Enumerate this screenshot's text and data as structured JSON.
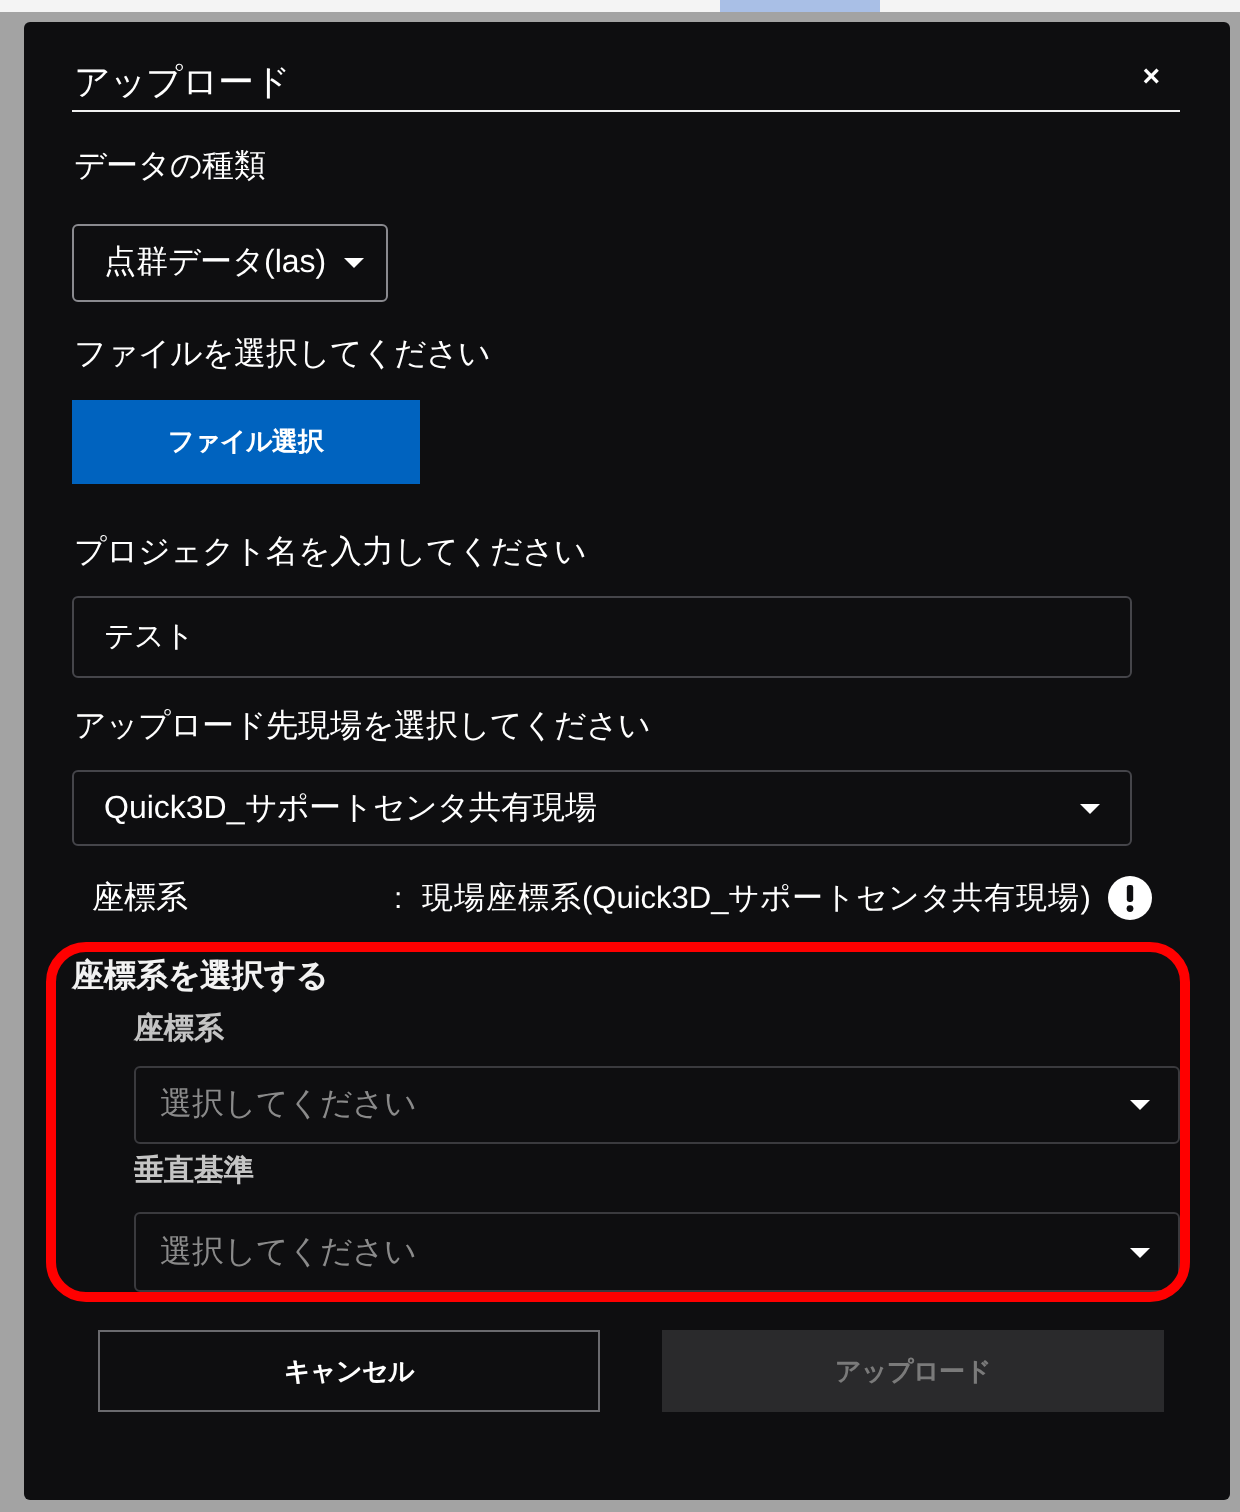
{
  "dialog": {
    "title": "アップロード",
    "close": "×"
  },
  "data_type": {
    "label": "データの種類",
    "value": "点群データ(las)"
  },
  "file": {
    "label": "ファイルを選択してください",
    "button": "ファイル選択"
  },
  "project_name": {
    "label": "プロジェクト名を入力してください",
    "value": "テスト"
  },
  "site": {
    "label": "アップロード先現場を選択してください",
    "value": "Quick3D_サポートセンタ共有現場"
  },
  "coordinate_info": {
    "label": "座標系",
    "separator": ":",
    "value": "現場座標系(Quick3D_サポートセンタ共有現場)"
  },
  "coordinate_selection": {
    "title": "座標系を選択する",
    "highlighted": true,
    "fields": [
      {
        "label": "座標系",
        "placeholder": "選択してください"
      },
      {
        "label": "垂直基準",
        "placeholder": "選択してください"
      }
    ]
  },
  "buttons": [
    {
      "label": "キャンセル",
      "disabled": false
    },
    {
      "label": "アップロード",
      "disabled": true
    }
  ]
}
